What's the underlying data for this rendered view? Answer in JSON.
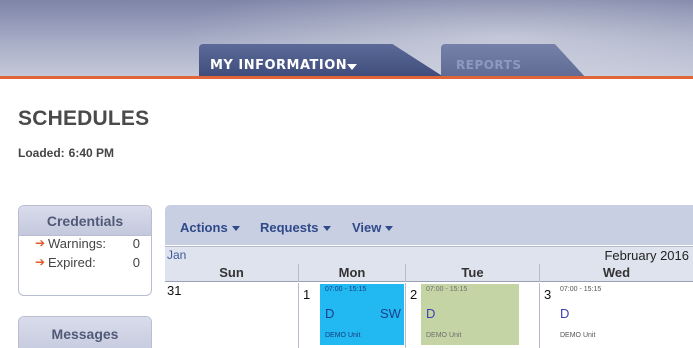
{
  "nav": {
    "tabs": [
      {
        "label": "MY INFORMATION",
        "active": true
      },
      {
        "label": "REPORTS",
        "active": false
      }
    ]
  },
  "page": {
    "title": "SCHEDULES",
    "loaded_label": "Loaded:",
    "loaded_time": "6:40 PM"
  },
  "credentials": {
    "title": "Credentials",
    "rows": [
      {
        "label": "Warnings:",
        "value": "0"
      },
      {
        "label": "Expired:",
        "value": "0"
      }
    ]
  },
  "messages": {
    "title": "Messages"
  },
  "calendar": {
    "toolbar": [
      "Actions",
      "Requests",
      "View"
    ],
    "prev_month": "Jan",
    "current_month": "February 2016",
    "days_of_week": [
      "Sun",
      "Mon",
      "Tue",
      "Wed"
    ],
    "days": [
      {
        "date": "31"
      },
      {
        "date": "1",
        "shift": {
          "time": "07:00 - 15:15",
          "code": "D",
          "extra": "SW",
          "unit": "DEMO Unit",
          "color": "#22b8f2"
        }
      },
      {
        "date": "2",
        "shift": {
          "time": "07:00 - 15:15",
          "code": "D",
          "unit": "DEMO Unit",
          "color": "#c5d4a5"
        }
      },
      {
        "date": "3",
        "shift": {
          "time": "07:00 - 15:15",
          "code": "D",
          "unit": "DEMO Unit",
          "color": "#ffffff"
        }
      }
    ]
  },
  "colors": {
    "accent": "#e0663a",
    "header": "#7d84a7",
    "tab": "#3e4b7a",
    "link": "#2f4a8a"
  }
}
